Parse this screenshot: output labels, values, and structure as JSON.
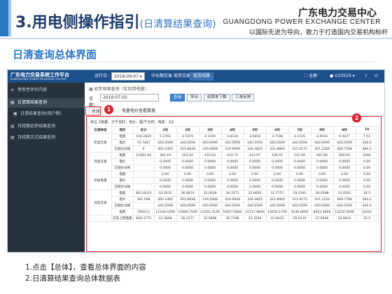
{
  "slide": {
    "title": "3.用电侧操作指引",
    "subtitle": "(日清算结果查询)",
    "org_cn": "广东电力交易中心",
    "org_en": "GUANGDONG POWER EXCHANGE CENTER",
    "org_slogan": "以国际先进为导向，致力于打造国内交易机构标杆",
    "section_title": "日清查询总体界面",
    "notes": [
      "1.点击【总体】，查看总体界面的内容",
      "2.日清算结果查询总体数据表"
    ],
    "markers": [
      "1",
      "2"
    ],
    "colors": {
      "accent": "#2b78c5",
      "header_dark": "#1d4f8c",
      "sidebar": "#28323c",
      "highlight_red": "#e0202a"
    }
  },
  "app": {
    "logo_cn": "广东电力交易系统工作平台",
    "logo_en": "GUANGDONG POWER EXCHANGE SYSTEM",
    "period_label": "运行日：",
    "period_value": "2018-09-07",
    "menus": [
      "中长期交易",
      "现货交易",
      "现货结算"
    ],
    "user_full": "全屏",
    "user_name": "U10519",
    "sidebar": [
      {
        "label": "债务性评价内容",
        "icon": "list-icon"
      },
      {
        "label": "日清算结果查询",
        "icon": "folder-icon"
      },
      {
        "label": "日清结果查询(用户侧)",
        "icon": "doc-icon"
      },
      {
        "label": "月结算初步结果查询",
        "icon": "folder-icon"
      },
      {
        "label": "月结算正式结果查询",
        "icon": "folder-icon"
      }
    ],
    "breadcrumb": "初步结果查询（实际用电量）",
    "date_label": "日期：",
    "date_value": "2018-07-02",
    "buttons": [
      "查询",
      "导出",
      "结算单下载",
      "工单反馈"
    ],
    "tabs": [
      "总体",
      "电量电价查看数据"
    ],
    "unit_text": "单位【电量：万千瓦时；电价：厘/千瓦时；电费：元】",
    "table": {
      "headers": [
        "交易种类",
        "项目",
        "合计",
        "1时",
        "2时",
        "3时",
        "4时",
        "5时",
        "6时",
        "7时",
        "8时",
        "9时",
        "10"
      ],
      "rows": [
        {
          "group": "年度交易",
          "span": 3,
          "item": "电量",
          "values": [
            "156.2829",
            "5.2355",
            "4.5479",
            "4.1105",
            "3.8134",
            "3.6416",
            "3.7196",
            "4.1105",
            "4.9543",
            "6.4077",
            "7.51"
          ]
        },
        {
          "item": "电价",
          "values": [
            "74.7487",
            "440.0599",
            "440.0599",
            "440.0599",
            "440.0599",
            "440.0599",
            "440.0599",
            "440.0599",
            "440.0599",
            "440.0599",
            "440.0"
          ]
        },
        {
          "item": "交割价价格",
          "values": [
            "0",
            "365.1495",
            "355.8838",
            "339.0908",
            "329.9949",
            "326.3825",
            "321.8900",
            "315.0175",
            "301.2329",
            "369.7789",
            "384.2"
          ]
        },
        {
          "group": "月度交易",
          "span": 3,
          "item": "电量",
          "values": [
            "11681.94",
            "392.19",
            "401.02",
            "415.03",
            "419.72",
            "413.97",
            "439.55",
            "511.99",
            "687.80",
            "920.00",
            "1060"
          ]
        },
        {
          "item": "电价",
          "values": [
            "",
            "0.0000",
            "0.0000",
            "0.0000",
            "0.0000",
            "0.0000",
            "0.0000",
            "0.0000",
            "0.0000",
            "0.0000",
            "0.00"
          ]
        },
        {
          "item": "交割价价格",
          "values": [
            "",
            "0.0000",
            "0.0000",
            "0.0000",
            "0.0000",
            "0.0000",
            "0.0000",
            "0.0000",
            "0.0000",
            "0.0000",
            "0.00"
          ]
        },
        {
          "group": "考核电量",
          "span": 3,
          "item": "电量",
          "values": [
            "",
            "0.00",
            "0.00",
            "0.00",
            "0.00",
            "0.00",
            "0.00",
            "0.00",
            "0.00",
            "0.00",
            "0.00"
          ]
        },
        {
          "item": "电价",
          "values": [
            "",
            "0.0000",
            "0.0000",
            "0.0000",
            "0.0000",
            "0.0000",
            "0.0000",
            "0.0000",
            "0.0000",
            "0.0000",
            "0.00"
          ]
        },
        {
          "item": "交割价价格",
          "values": [
            "",
            "0.0000",
            "0.0000",
            "0.0000",
            "0.0000",
            "0.0000",
            "0.0000",
            "0.0000",
            "0.0000",
            "0.0000",
            "0.00"
          ]
        },
        {
          "group": "日前交易",
          "span": 4,
          "item": "电量",
          "values": [
            "801.6143",
            "33.3015",
            "36.6874",
            "32.6028",
            "30.3571",
            "32.8693",
            "32.7757",
            "29.3191",
            "28.0598",
            "33.0591",
            "34.5"
          ]
        },
        {
          "item": "电价",
          "values": [
            "361.508",
            "365.1495",
            "355.8838",
            "339.0908",
            "329.9949",
            "326.3825",
            "321.8900",
            "315.0175",
            "301.2329",
            "369.7789",
            "384.2"
          ]
        },
        {
          "item": "交割价价格",
          "values": [
            "",
            "440.0599",
            "440.0599",
            "440.0599",
            "440.0599",
            "440.0599",
            "440.0599",
            "440.0599",
            "440.0599",
            "440.0599",
            "440.0"
          ]
        },
        {
          "item": "电费",
          "values": [
            "290513",
            "12160.0300",
            "12909.7000",
            "11055.3100",
            "10017.6900",
            "10727.9600",
            "10550.1700",
            "9236.0000",
            "8452.4800",
            "12224.5600",
            "14201"
          ]
        },
        {
          "group": "",
          "span": 1,
          "item": "实际上网电量",
          "values": [
            "808.3775",
            "33.1808",
            "36.3177",
            "32.5896",
            "30.7198",
            "33.3584",
            "31.8422",
            "29.4119",
            "27.9246",
            "33.8011",
            "35.5"
          ]
        }
      ]
    }
  }
}
